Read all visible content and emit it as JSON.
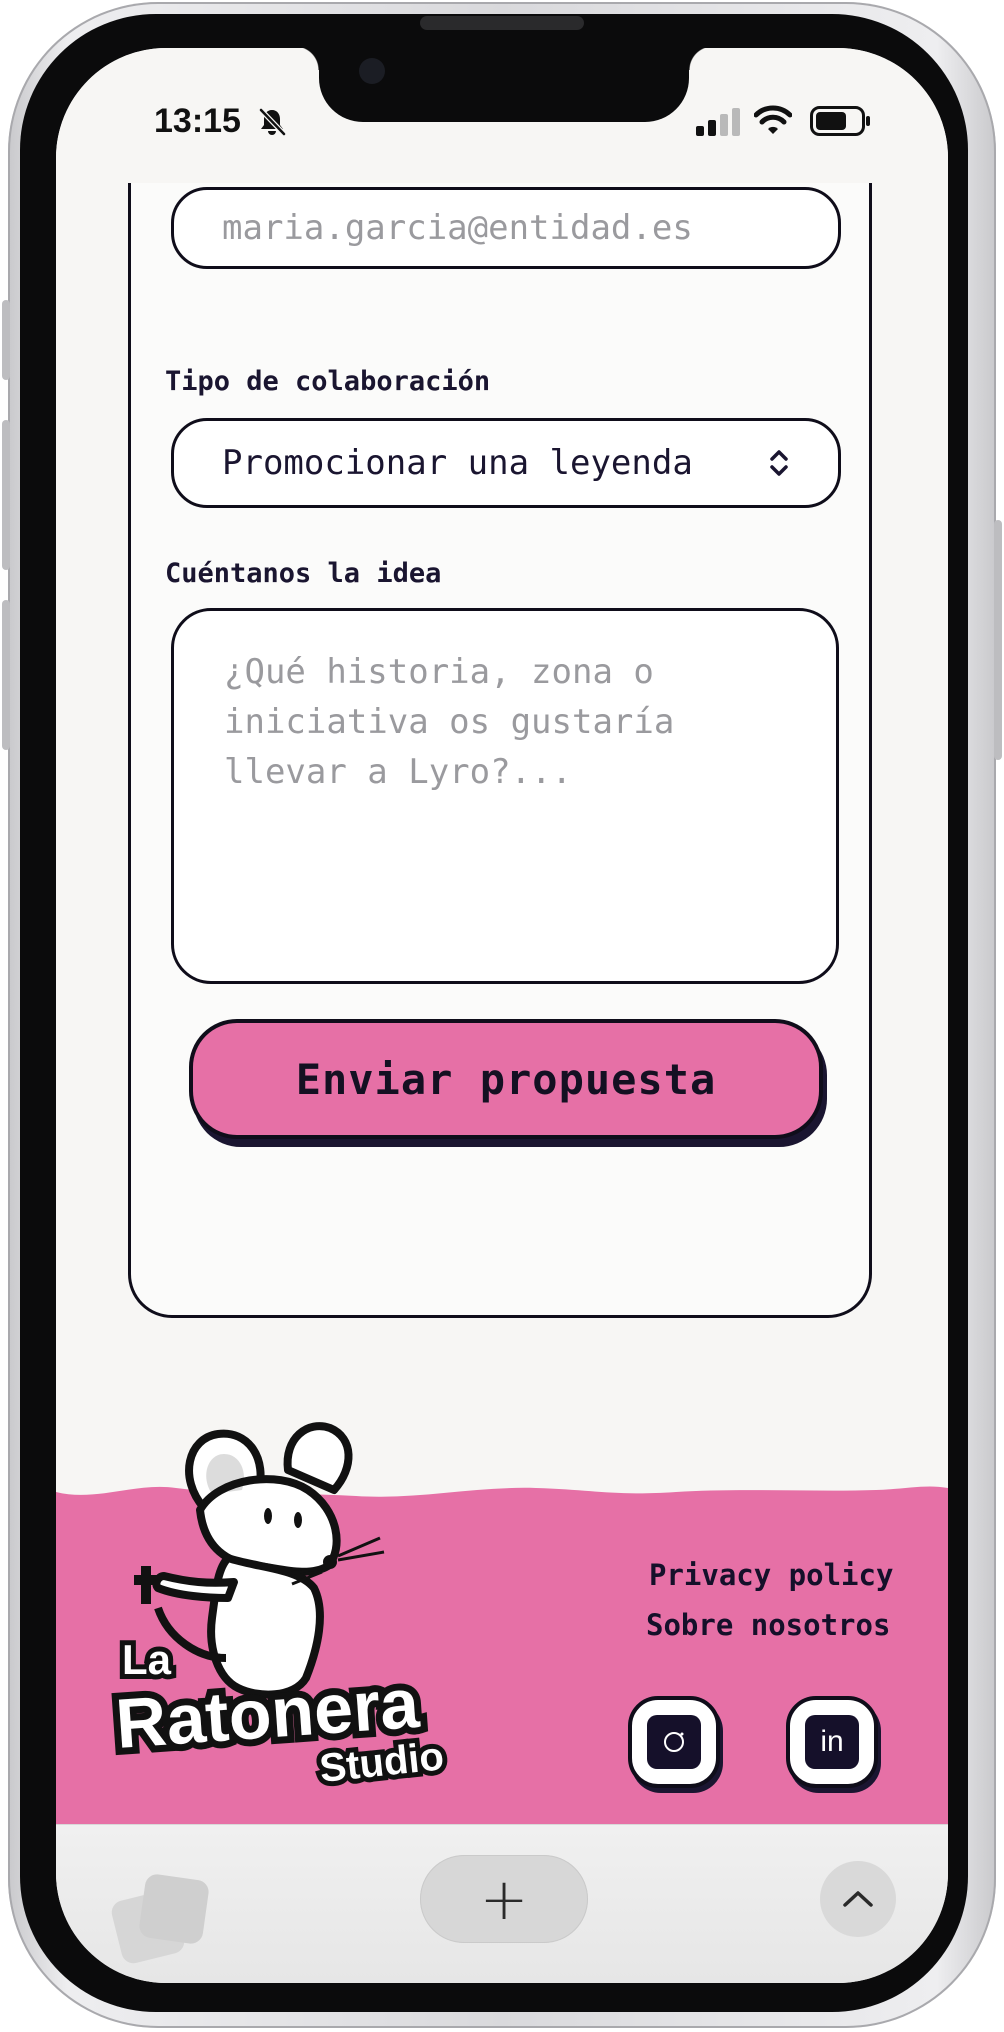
{
  "status_bar": {
    "time": "13:15",
    "icons": [
      "bell-slash-icon",
      "cellular-signal-icon",
      "wifi-icon",
      "battery-icon"
    ]
  },
  "form": {
    "email_value": "maria.garcia@entidad.es",
    "collab_label": "Tipo de colaboración",
    "collab_selected": "Promocionar una leyenda",
    "idea_label": "Cuéntanos la idea",
    "idea_placeholder": "¿Qué historia, zona o iniciativa os gustaría llevar a Lyro?...",
    "submit_label": "Enviar propuesta"
  },
  "footer": {
    "brand_line1": "La",
    "brand_line2": "Ratonera",
    "brand_line3": "Studio",
    "links": [
      "Privacy policy",
      "Sobre nosotros"
    ],
    "social": [
      "instagram-icon",
      "linkedin-icon"
    ],
    "linkedin_glyph": "in"
  },
  "browser_bar": {
    "new_tab_label": "+",
    "icons": [
      "tabs-icon",
      "plus-icon",
      "chevron-up-icon"
    ]
  },
  "colors": {
    "accent_pink": "#e670a6",
    "ink": "#15102a",
    "page_bg": "#f7f6f4"
  }
}
